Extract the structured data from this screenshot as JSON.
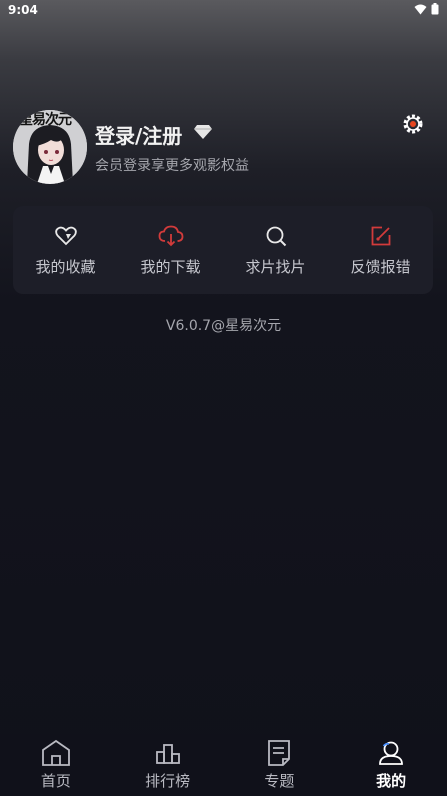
{
  "status": {
    "time": "9:04",
    "icons": [
      "wifi-icon",
      "battery-icon"
    ]
  },
  "profile": {
    "avatar_text": "星易次元",
    "login_label": "登录/注册",
    "subtitle": "会员登录享更多观影权益",
    "icons": [
      "diamond-icon",
      "settings-icon"
    ]
  },
  "actions": [
    {
      "label": "我的收藏",
      "icon": "heart-icon",
      "color": "#e8e8e8"
    },
    {
      "label": "我的下载",
      "icon": "cloud-download-icon",
      "color": "#d23b3b"
    },
    {
      "label": "求片找片",
      "icon": "search-icon",
      "color": "#e8e8e8"
    },
    {
      "label": "反馈报错",
      "icon": "feedback-edit-icon",
      "color": "#d23b3b"
    }
  ],
  "version": "V6.0.7@星易次元",
  "tabs": [
    {
      "label": "首页",
      "icon": "home-icon",
      "active": false
    },
    {
      "label": "排行榜",
      "icon": "ranking-icon",
      "active": false
    },
    {
      "label": "专题",
      "icon": "topic-icon",
      "active": false
    },
    {
      "label": "我的",
      "icon": "user-icon",
      "active": true
    }
  ]
}
